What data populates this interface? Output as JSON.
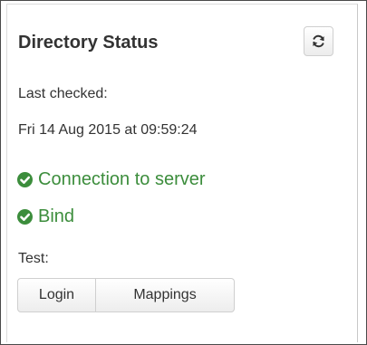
{
  "panel": {
    "title": "Directory Status",
    "last_checked_label": "Last checked:",
    "last_checked_value": "Fri 14 Aug 2015 at 09:59:24"
  },
  "statuses": [
    {
      "label": "Connection to server",
      "state": "ok",
      "icon": "check-circle-icon"
    },
    {
      "label": "Bind",
      "state": "ok",
      "icon": "check-circle-icon"
    }
  ],
  "test": {
    "label": "Test:",
    "buttons": [
      {
        "label": "Login"
      },
      {
        "label": "Mappings"
      }
    ]
  },
  "icons": {
    "refresh": "refresh-icon"
  },
  "colors": {
    "success": "#3c8d3c",
    "text": "#333333"
  }
}
